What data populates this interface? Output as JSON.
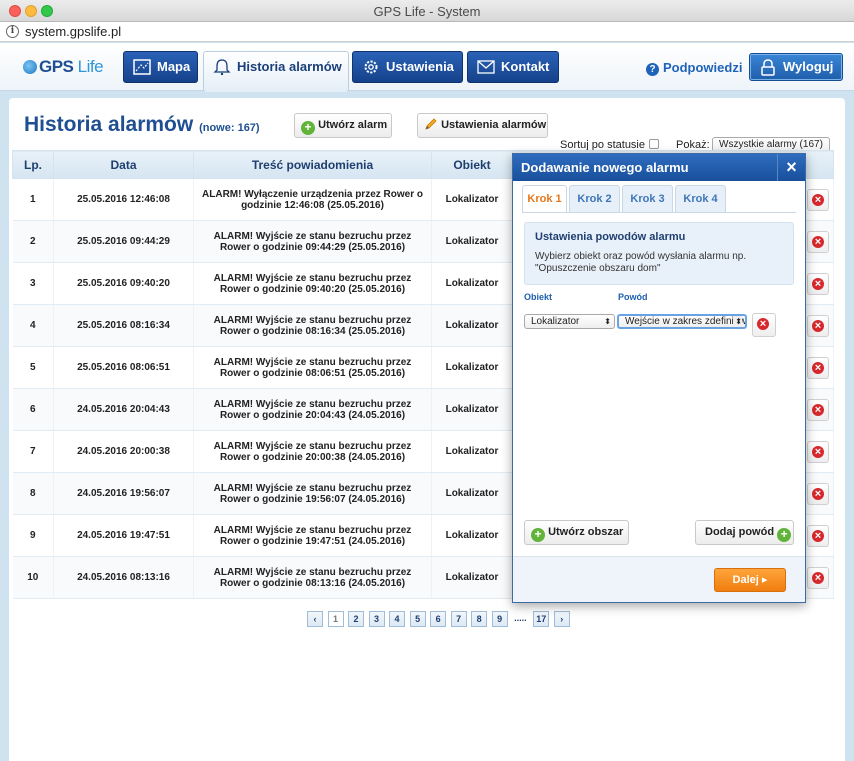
{
  "window": {
    "title": "GPS Life - System"
  },
  "browser": {
    "url": "system.gpslife.pl"
  },
  "logo": {
    "part1": "GPS",
    "part2": "Life"
  },
  "nav": {
    "map": "Mapa",
    "history": "Historia alarmów",
    "settings": "Ustawienia",
    "contact": "Kontakt",
    "help": "Podpowiedzi",
    "logout": "Wyloguj"
  },
  "page": {
    "title": "Historia alarmów",
    "new_count": "(nowe: 167)",
    "create_alarm": "Utwórz alarm",
    "alarm_settings": "Ustawienia alarmów",
    "sort_label": "Sortuj po statusie",
    "show_label": "Pokaż:",
    "show_value": "Wszystkie alarmy (167)"
  },
  "table": {
    "headers": [
      "Lp.",
      "Data",
      "Treść powiadomienia",
      "Obiekt"
    ],
    "rows": [
      {
        "lp": "1",
        "date": "25.05.2016 12:46:08",
        "msg1": "ALARM! Wyłączenie urządzenia przez Rower o",
        "msg2": "godzinie 12:46:08 (25.05.2016)",
        "obj": "Lokalizator"
      },
      {
        "lp": "2",
        "date": "25.05.2016 09:44:29",
        "msg1": "ALARM! Wyjście ze stanu bezruchu przez",
        "msg2": "Rower o godzinie 09:44:29 (25.05.2016)",
        "obj": "Lokalizator"
      },
      {
        "lp": "3",
        "date": "25.05.2016 09:40:20",
        "msg1": "ALARM! Wyjście ze stanu bezruchu przez",
        "msg2": "Rower o godzinie 09:40:20 (25.05.2016)",
        "obj": "Lokalizator"
      },
      {
        "lp": "4",
        "date": "25.05.2016 08:16:34",
        "msg1": "ALARM! Wyjście ze stanu bezruchu przez",
        "msg2": "Rower o godzinie 08:16:34 (25.05.2016)",
        "obj": "Lokalizator"
      },
      {
        "lp": "5",
        "date": "25.05.2016 08:06:51",
        "msg1": "ALARM! Wyjście ze stanu bezruchu przez",
        "msg2": "Rower o godzinie 08:06:51 (25.05.2016)",
        "obj": "Lokalizator"
      },
      {
        "lp": "6",
        "date": "24.05.2016 20:04:43",
        "msg1": "ALARM! Wyjście ze stanu bezruchu przez",
        "msg2": "Rower o godzinie 20:04:43 (24.05.2016)",
        "obj": "Lokalizator"
      },
      {
        "lp": "7",
        "date": "24.05.2016 20:00:38",
        "msg1": "ALARM! Wyjście ze stanu bezruchu przez",
        "msg2": "Rower o godzinie 20:00:38 (24.05.2016)",
        "obj": "Lokalizator"
      },
      {
        "lp": "8",
        "date": "24.05.2016 19:56:07",
        "msg1": "ALARM! Wyjście ze stanu bezruchu przez",
        "msg2": "Rower o godzinie 19:56:07 (24.05.2016)",
        "obj": "Lokalizator"
      },
      {
        "lp": "9",
        "date": "24.05.2016 19:47:51",
        "msg1": "ALARM! Wyjście ze stanu bezruchu przez",
        "msg2": "Rower o godzinie 19:47:51 (24.05.2016)",
        "obj": "Lokalizator"
      },
      {
        "lp": "10",
        "date": "24.05.2016 08:13:16",
        "msg1": "ALARM! Wyjście ze stanu bezruchu przez",
        "msg2": "Rower o godzinie 08:13:16 (24.05.2016)",
        "obj": "Lokalizator"
      }
    ]
  },
  "pagination": {
    "prev": "‹",
    "pages": [
      "1",
      "2",
      "3",
      "4",
      "5",
      "6",
      "7",
      "8",
      "9"
    ],
    "dots": ".....",
    "last": "17",
    "next": "›",
    "current": "1"
  },
  "modal": {
    "title": "Dodawanie nowego alarmu",
    "close": "×",
    "tabs": [
      "Krok 1",
      "Krok 2",
      "Krok 3",
      "Krok 4"
    ],
    "info_title": "Ustawienia powodów alarmu",
    "info_text1": "Wybierz obiekt oraz powód wysłania alarmu np.",
    "info_text2": "\"Opuszczenie obszaru dom\"",
    "object_label": "Obiekt",
    "reason_label": "Powód",
    "object_value": "Lokalizator",
    "reason_value": "Wejście w zakres zdefiniowanego obszaru",
    "create_area": "Utwórz obszar",
    "add_reason": "Dodaj powód",
    "next": "Dalej"
  },
  "colors": {
    "brand": "#1f4f92",
    "accent": "#f07d10",
    "danger": "#d7282e",
    "success": "#62b33a"
  }
}
